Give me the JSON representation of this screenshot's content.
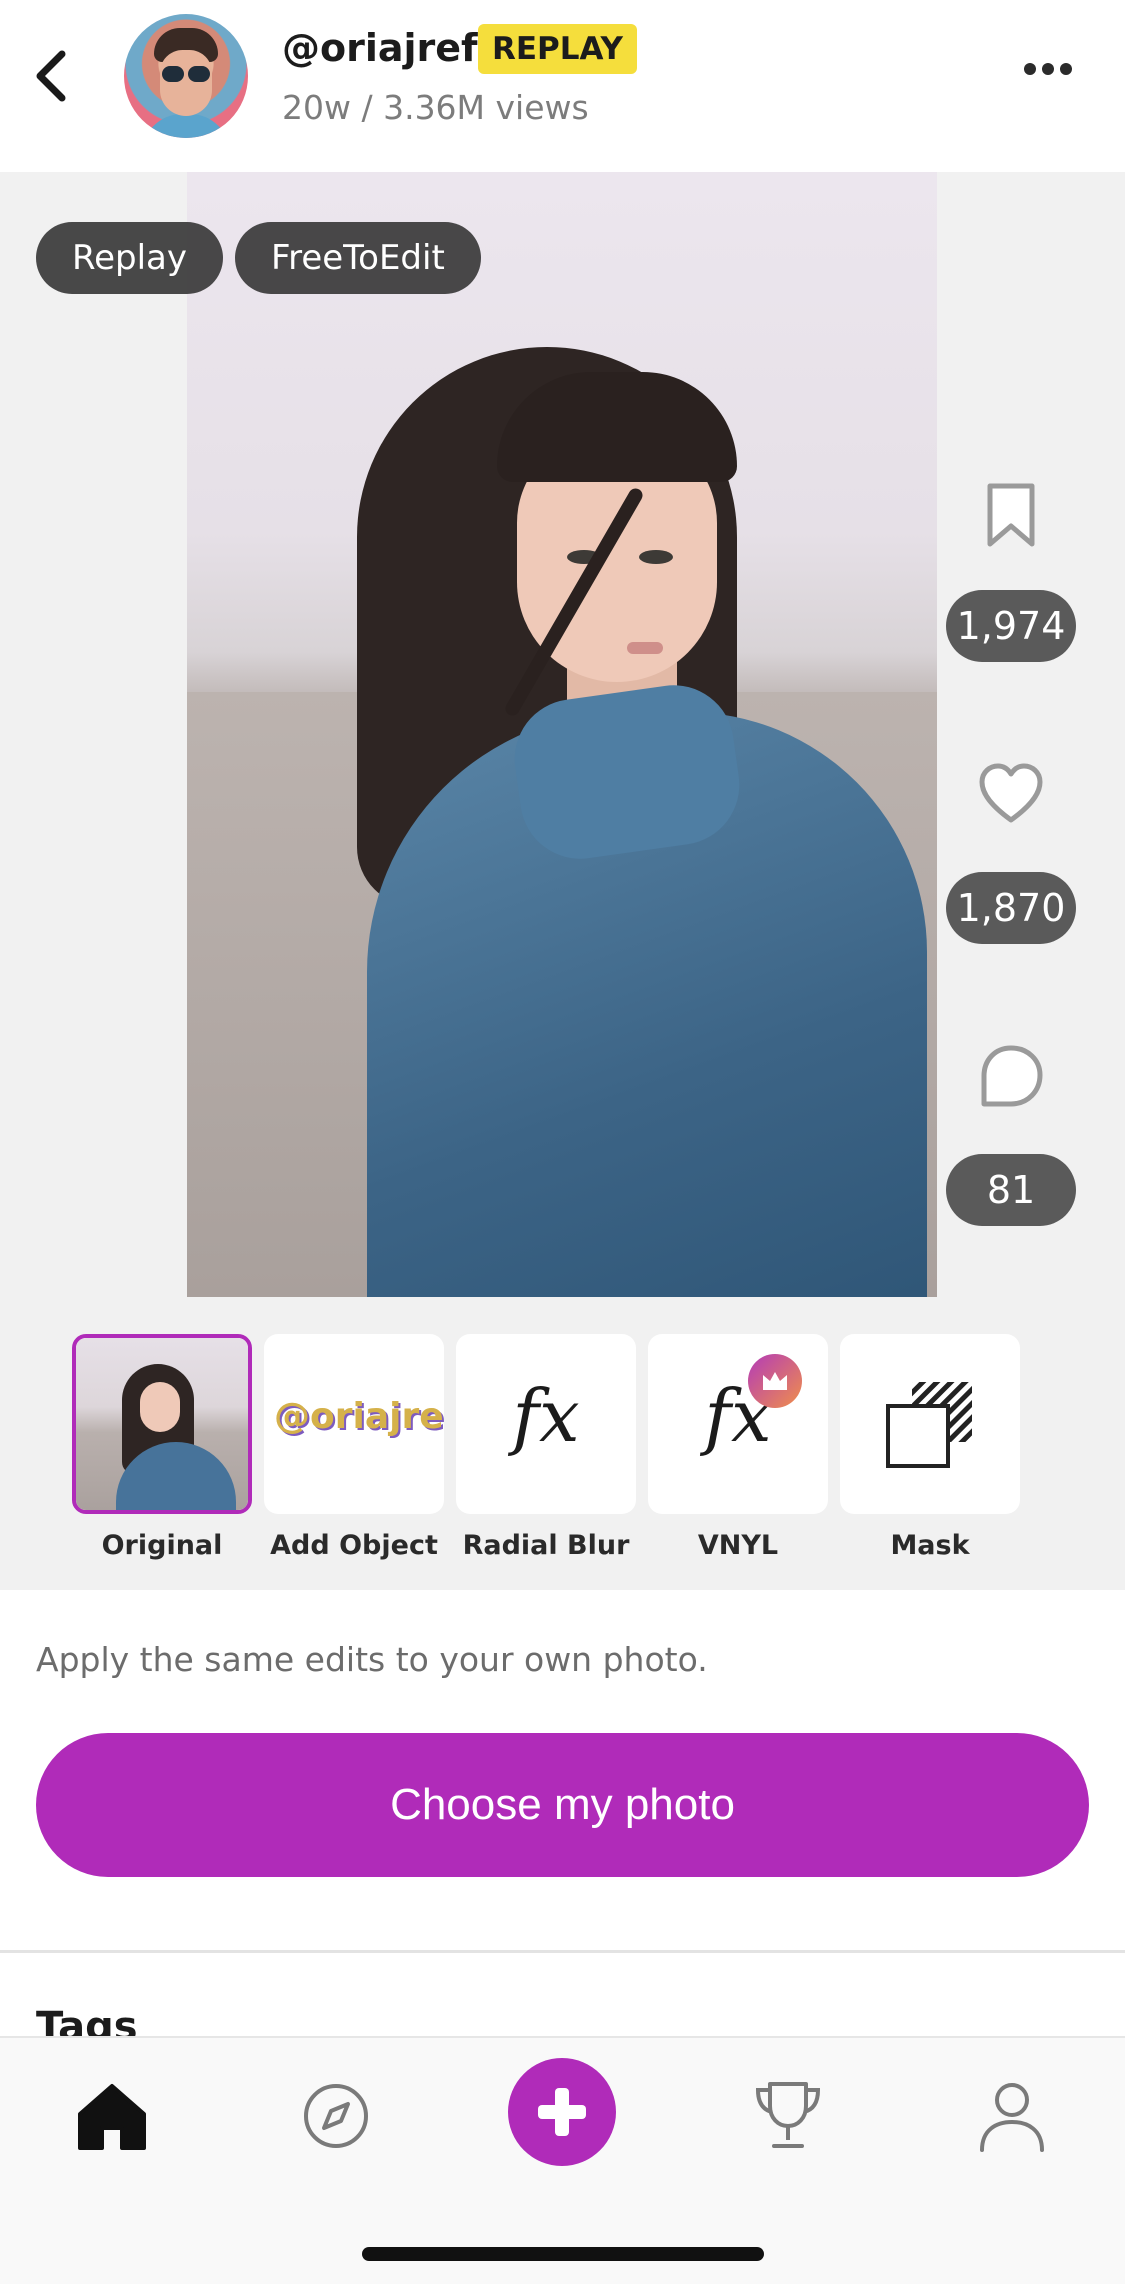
{
  "header": {
    "username": "@oriajref",
    "badge": "REPLAY",
    "meta": "20w / 3.36M views"
  },
  "post": {
    "chips": [
      "Replay",
      "FreeToEdit"
    ],
    "actions": {
      "saves": "1,974",
      "likes": "1,870",
      "comments": "81"
    }
  },
  "steps": [
    {
      "label": "Original",
      "icon": "photo-thumbnail",
      "selected": true
    },
    {
      "label": "Add Object",
      "icon": "oriajref-wordmark",
      "wordmark": "@oriajref"
    },
    {
      "label": "Radial Blur",
      "icon": "fx-icon",
      "glyph": "fx"
    },
    {
      "label": "VNYL",
      "icon": "fx-icon",
      "glyph": "fx",
      "premium": true
    },
    {
      "label": "Mask",
      "icon": "mask-icon"
    }
  ],
  "cta": {
    "apply_text": "Apply the same edits to your own photo.",
    "button": "Choose my photo"
  },
  "tags": {
    "title": "Tags"
  },
  "tabbar": {
    "items": [
      "home-icon",
      "explore-icon",
      "add-icon",
      "trophy-icon",
      "profile-icon"
    ]
  },
  "colors": {
    "accent": "#b02bb9",
    "badge": "#f5de3c",
    "pill": "#5a5a5a"
  }
}
